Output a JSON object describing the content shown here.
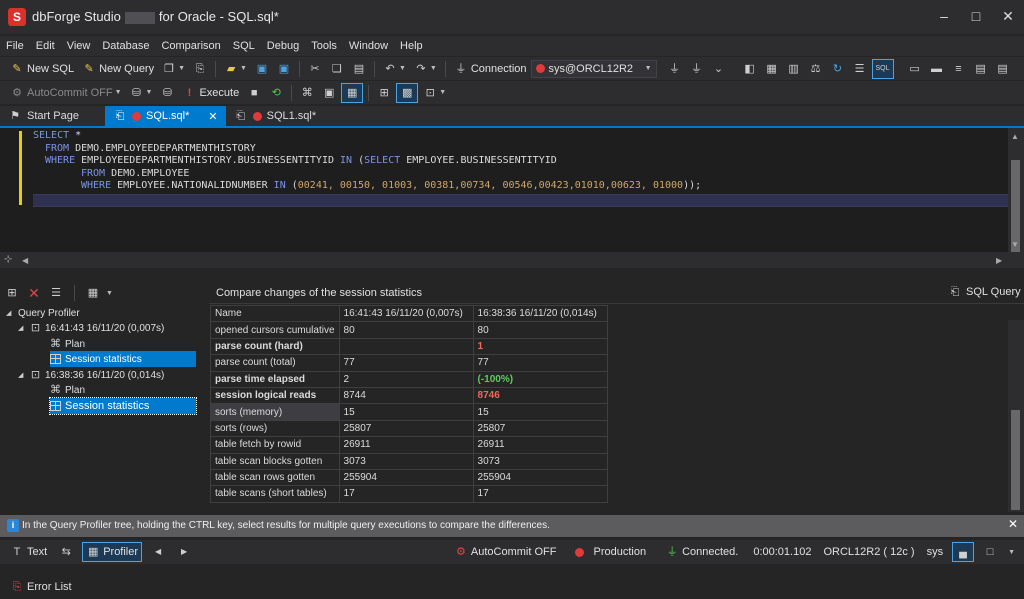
{
  "window": {
    "logo_letter": "S",
    "title_prefix": "dbForge Studio",
    "title_suffix": "for Oracle - SQL.sql*",
    "minimize": "–",
    "maximize": "□",
    "close": "✕"
  },
  "menu": [
    "File",
    "Edit",
    "View",
    "Database",
    "Comparison",
    "SQL",
    "Debug",
    "Tools",
    "Window",
    "Help"
  ],
  "toolbar1": {
    "new_sql": "New SQL",
    "new_query": "New Query",
    "connection_label": "Connection",
    "connection_value": "sys@ORCL12R2"
  },
  "toolbar2": {
    "autocommit": "AutoCommit OFF",
    "execute": "Execute"
  },
  "tabs": {
    "start_page": "Start Page",
    "sql_tab": "SQL.sql*",
    "sql1_tab": "SQL1.sql*"
  },
  "editor": {
    "line1": [
      "SELECT",
      " *"
    ],
    "line2": [
      "FROM",
      " DEMO.EMPLOYEEDEPARTMENTHISTORY"
    ],
    "line3": [
      "WHERE",
      " EMPLOYEEDEPARTMENTHISTORY.BUSINESSENTITYID ",
      "IN",
      " (",
      "SELECT",
      " EMPLOYEE.BUSINESSENTITYID"
    ],
    "line4": [
      "FROM",
      " DEMO.EMPLOYEE"
    ],
    "line5": [
      "WHERE",
      " EMPLOYEE.NATIONALIDNUMBER ",
      "IN",
      " (",
      "00241, 00150, 01003, 00381,00734, 00546,00423,01010,00623, 01000",
      "));"
    ]
  },
  "tree": {
    "root": "Query Profiler",
    "run1": "16:41:43 16/11/20 (0,007s)",
    "run2": "16:38:36 16/11/20 (0,014s)",
    "plan": "Plan",
    "session_stats": "Session statistics"
  },
  "compare": {
    "title": "Compare changes of the session statistics",
    "sql_query_button": "SQL Query",
    "columns": [
      "Name",
      "16:41:43 16/11/20 (0,007s)",
      "16:38:36 16/11/20 (0,014s)"
    ],
    "rows": [
      {
        "name": "opened cursors cumulative",
        "v1": "80",
        "v2": "80",
        "bold": false,
        "style2": ""
      },
      {
        "name": "parse count (hard)",
        "v1": "",
        "v2": "1",
        "bold": true,
        "style2": "red"
      },
      {
        "name": "parse count (total)",
        "v1": "77",
        "v2": "77",
        "bold": false,
        "style2": ""
      },
      {
        "name": "parse time elapsed",
        "v1": "2",
        "v2": "(-100%)",
        "bold": true,
        "style2": "green"
      },
      {
        "name": "session logical reads",
        "v1": "8744",
        "v2": "8746",
        "bold": true,
        "style2": "red"
      },
      {
        "name": "sorts (memory)",
        "v1": "15",
        "v2": "15",
        "bold": false,
        "style2": ""
      },
      {
        "name": "sorts (rows)",
        "v1": "25807",
        "v2": "25807",
        "bold": false,
        "style2": ""
      },
      {
        "name": "table fetch by rowid",
        "v1": "26911",
        "v2": "26911",
        "bold": false,
        "style2": ""
      },
      {
        "name": "table scan blocks gotten",
        "v1": "3073",
        "v2": "3073",
        "bold": false,
        "style2": ""
      },
      {
        "name": "table scan rows gotten",
        "v1": "255904",
        "v2": "255904",
        "bold": false,
        "style2": ""
      },
      {
        "name": "table scans (short tables)",
        "v1": "17",
        "v2": "17",
        "bold": false,
        "style2": ""
      }
    ]
  },
  "info_bar": {
    "icon": "i",
    "text": "In the Query Profiler tree, holding the CTRL key, select results for multiple query executions to compare the differences.",
    "close": "✕"
  },
  "status": {
    "text_tab": "Text",
    "profiler_tab": "Profiler",
    "autocommit": "AutoCommit OFF",
    "environment": "Production",
    "connection_state": "Connected.",
    "elapsed": "0:00:01.102",
    "server": "ORCL12R2 ( 12c )",
    "user": "sys"
  },
  "error_list": "Error List",
  "colors": {
    "accent": "#007acc",
    "warn_red": "#f06a5a",
    "good_green": "#5ecb5e"
  }
}
